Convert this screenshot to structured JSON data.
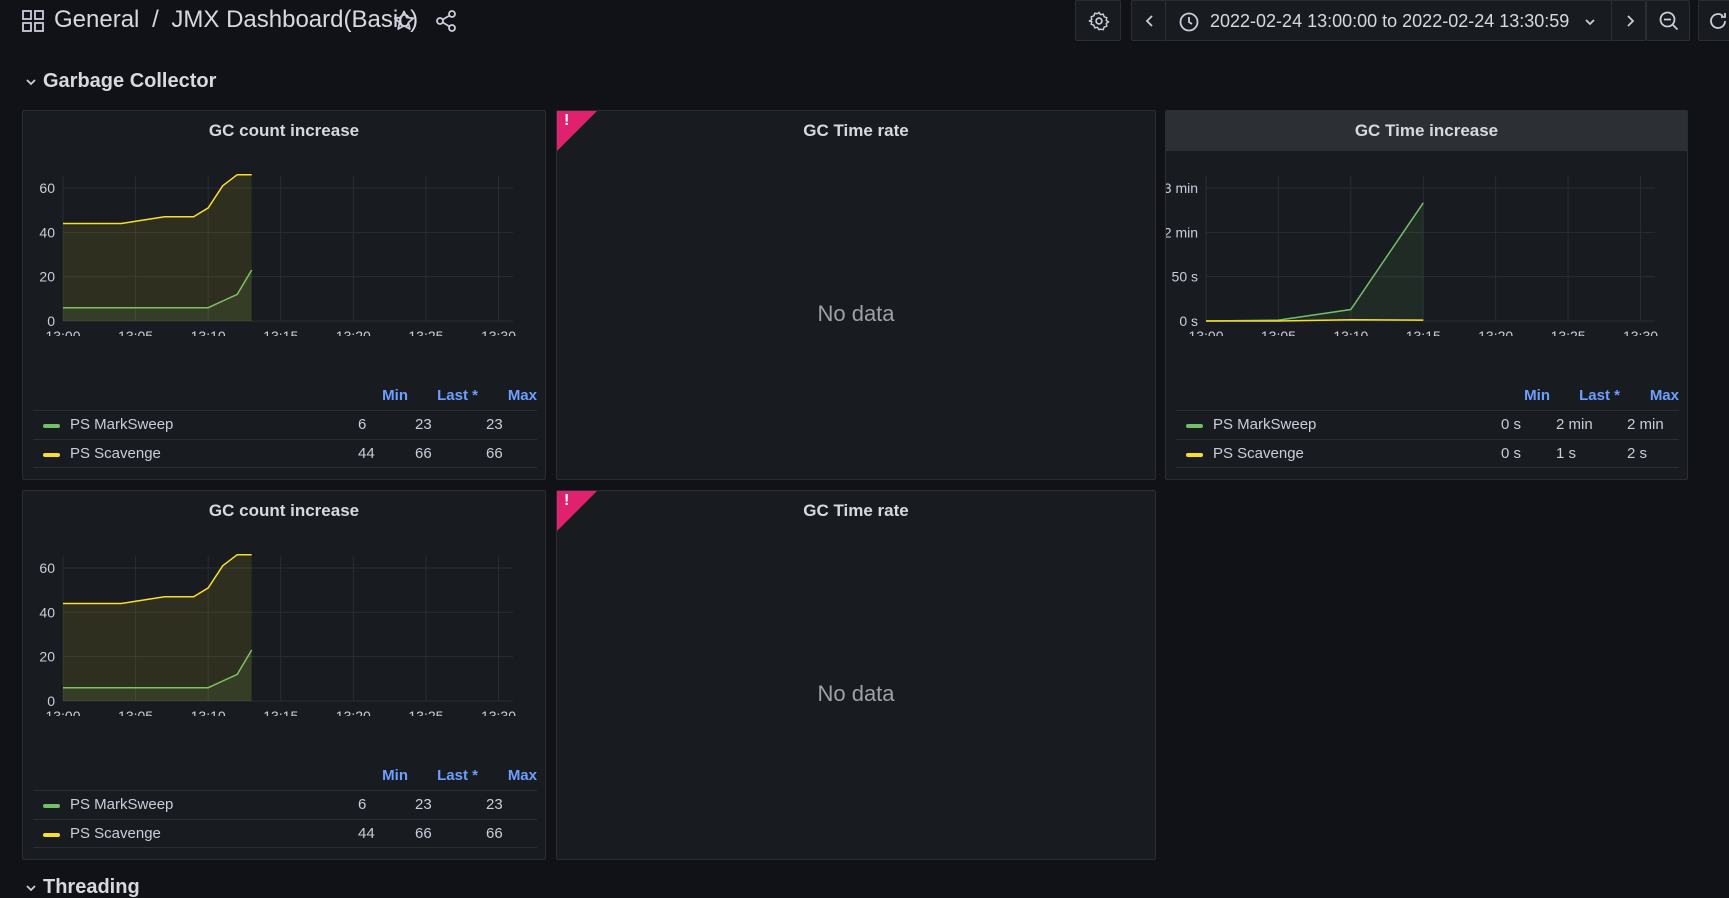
{
  "breadcrumb": {
    "folder": "General",
    "separator": "/",
    "dashboard": "JMX Dashboard(Basic)"
  },
  "timerange": {
    "label": "2022-02-24 13:00:00 to 2022-02-24 13:30:59"
  },
  "icons": [
    "apps-icon",
    "star-icon",
    "share-icon",
    "gear-icon",
    "chevron-left-icon",
    "clock-icon",
    "chevron-down-icon",
    "chevron-right-icon",
    "zoom-out-icon",
    "refresh-icon",
    "alert-icon"
  ],
  "rows": {
    "gc": "Garbage Collector",
    "threading": "Threading"
  },
  "colors": {
    "markSweep": "#73bf69",
    "scavenge": "#fade2a",
    "error": "#e0226e",
    "legendHeader": "#6e9fff"
  },
  "legend_headers": {
    "min": "Min",
    "last": "Last *",
    "max": "Max"
  },
  "panels": {
    "gc_count_1": {
      "title": "GC count increase",
      "legend": [
        {
          "name": "PS MarkSweep",
          "min": "6",
          "last": "23",
          "max": "23"
        },
        {
          "name": "PS Scavenge",
          "min": "44",
          "last": "66",
          "max": "66"
        }
      ]
    },
    "gc_time_rate_1": {
      "title": "GC Time rate",
      "message": "No data"
    },
    "gc_time_increase": {
      "title": "GC Time increase",
      "legend": [
        {
          "name": "PS MarkSweep",
          "min": "0 s",
          "last": "2 min",
          "max": "2 min"
        },
        {
          "name": "PS Scavenge",
          "min": "0 s",
          "last": "1 s",
          "max": "2 s"
        }
      ]
    },
    "gc_count_2": {
      "title": "GC count increase",
      "legend": [
        {
          "name": "PS MarkSweep",
          "min": "6",
          "last": "23",
          "max": "23"
        },
        {
          "name": "PS Scavenge",
          "min": "44",
          "last": "66",
          "max": "66"
        }
      ]
    },
    "gc_time_rate_2": {
      "title": "GC Time rate",
      "message": "No data"
    }
  },
  "chart_data": [
    {
      "type": "area",
      "title": "GC count increase",
      "x": [
        "13:00",
        "13:02",
        "13:04",
        "13:05",
        "13:06",
        "13:07",
        "13:08",
        "13:09",
        "13:10",
        "13:11",
        "13:12",
        "13:13"
      ],
      "xticks": [
        "13:00",
        "13:05",
        "13:10",
        "13:15",
        "13:20",
        "13:25",
        "13:30"
      ],
      "yticks": [
        "0",
        "20",
        "40",
        "60"
      ],
      "ylim": [
        0,
        72
      ],
      "series": [
        {
          "name": "PS MarkSweep",
          "values": [
            6,
            6,
            6,
            6,
            6,
            6,
            6,
            6,
            6,
            9,
            12,
            23
          ]
        },
        {
          "name": "PS Scavenge",
          "values": [
            44,
            44,
            44,
            45,
            46,
            47,
            47,
            47,
            51,
            61,
            66,
            66
          ]
        }
      ]
    },
    {
      "type": "area",
      "title": "GC Time increase",
      "x": [
        "13:00",
        "13:05",
        "13:10",
        "13:15"
      ],
      "xticks": [
        "13:00",
        "13:05",
        "13:10",
        "13:15",
        "13:20",
        "13:25",
        "13:30"
      ],
      "yticks": [
        "0 s",
        "50 s",
        "2 min",
        "3 min"
      ],
      "ylim": [
        0,
        185
      ],
      "series": [
        {
          "name": "PS MarkSweep",
          "values": [
            0,
            1,
            13,
            160
          ]
        },
        {
          "name": "PS Scavenge",
          "values": [
            0,
            0,
            1.5,
            1
          ]
        }
      ]
    },
    {
      "type": "area",
      "title": "GC count increase",
      "x": [
        "13:00",
        "13:02",
        "13:04",
        "13:05",
        "13:06",
        "13:07",
        "13:08",
        "13:09",
        "13:10",
        "13:11",
        "13:12",
        "13:13"
      ],
      "xticks": [
        "13:00",
        "13:05",
        "13:10",
        "13:15",
        "13:20",
        "13:25",
        "13:30"
      ],
      "yticks": [
        "0",
        "20",
        "40",
        "60"
      ],
      "ylim": [
        0,
        72
      ],
      "series": [
        {
          "name": "PS MarkSweep",
          "values": [
            6,
            6,
            6,
            6,
            6,
            6,
            6,
            6,
            6,
            9,
            12,
            23
          ]
        },
        {
          "name": "PS Scavenge",
          "values": [
            44,
            44,
            44,
            45,
            46,
            47,
            47,
            47,
            51,
            61,
            66,
            66
          ]
        }
      ]
    }
  ]
}
